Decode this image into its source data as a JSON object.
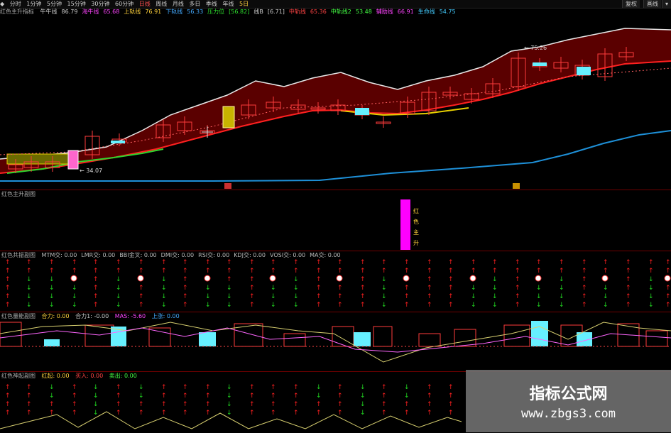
{
  "toolbar": {
    "items": [
      "分时",
      "1分钟",
      "5分钟",
      "15分钟",
      "30分钟",
      "60分钟",
      "日线",
      "周线",
      "月线",
      "多日",
      "季线",
      "年线",
      "5日"
    ],
    "right_labels": [
      "复权",
      "画线",
      "▾"
    ],
    "left_label": "◆"
  },
  "main": {
    "title": "红色主升指标",
    "readouts": [
      {
        "label": "牛牛线",
        "value": "86.79",
        "color": "#cccccc"
      },
      {
        "label": "海牛线",
        "value": "65.68",
        "color": "#ff44ff"
      },
      {
        "label": "上轨线",
        "value": "76.91",
        "color": "#ffd23c"
      },
      {
        "label": "下轨线",
        "value": "56.33",
        "color": "#44aaff"
      },
      {
        "label": "压力位",
        "value": "[56.82]",
        "color": "#2ee02e"
      },
      {
        "label": "线B",
        "value": "[6.71]",
        "color": "#cccccc"
      },
      {
        "label": "中轨线",
        "value": "65.36",
        "color": "#ff4444"
      },
      {
        "label": "中轨线2",
        "value": "53.48",
        "color": "#44ff44"
      },
      {
        "label": "辅助线",
        "value": "66.91",
        "color": "#ff44ff"
      },
      {
        "label": "生命线",
        "value": "54.75",
        "color": "#44ccff"
      }
    ],
    "price_labels": {
      "high": "75.26",
      "low": "34.07"
    },
    "markers": {
      "red": "◆",
      "yellow": "◆"
    }
  },
  "sub1": {
    "title": "红色主升副图",
    "bar_labels": [
      "红",
      "色",
      "主",
      "升"
    ]
  },
  "sub2": {
    "title": "红色共振副图",
    "readouts": [
      "MTM交: 0.00",
      "LMR交: 0.00",
      "BBI金叉: 0.00",
      "DMI交: 0.00",
      "RSI交: 0.00",
      "KDJ交: 0.00",
      "VOSI交: 0.00",
      "MA交: 0.00"
    ]
  },
  "sub3": {
    "title": "红色量能副图",
    "readouts": [
      "合力: 0.00",
      "合力1: -0.00",
      "MAS: -5.60",
      "上涨: 0.00"
    ]
  },
  "sub4": {
    "title": "红色神起副图",
    "readouts": [
      "红起: 0.00",
      "买入: 0.00",
      "卖出: 0.00"
    ]
  },
  "watermark": {
    "title": "指标公式网",
    "url": "www.zbgs3.com"
  },
  "colors": {
    "bg": "#000000",
    "band": "#5a0000",
    "candle": "#ff3b3b",
    "upper": "#e8e8e8",
    "lower": "#ff2020",
    "blue": "#1e90d8",
    "cyan": "#66f0ff",
    "magenta": "#ff00ff"
  }
}
